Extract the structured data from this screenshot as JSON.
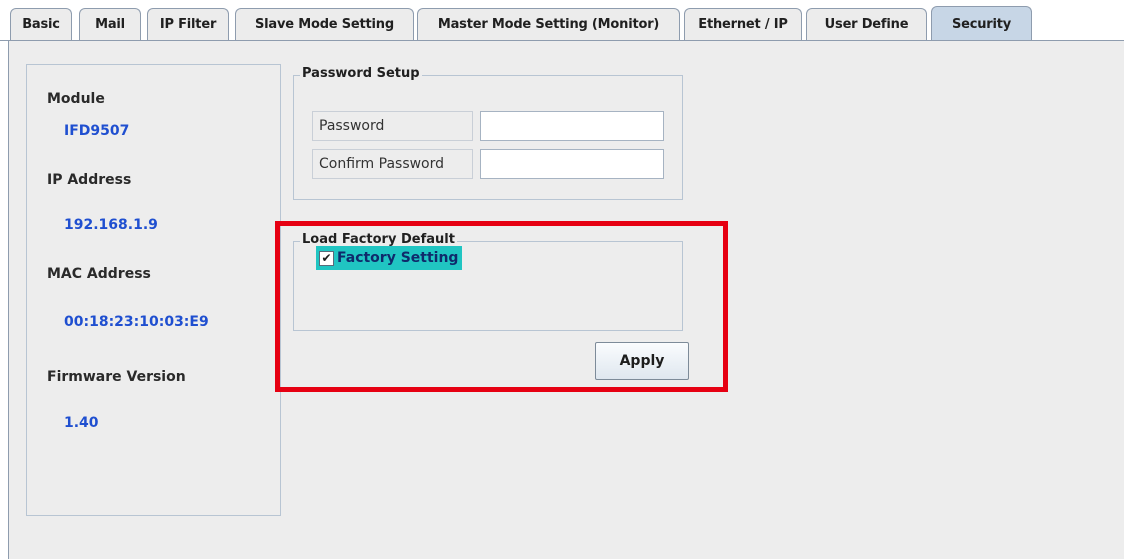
{
  "tabs": [
    {
      "label": "Basic"
    },
    {
      "label": "Mail"
    },
    {
      "label": "IP Filter"
    },
    {
      "label": "Slave Mode Setting"
    },
    {
      "label": "Master Mode Setting (Monitor)"
    },
    {
      "label": "Ethernet / IP"
    },
    {
      "label": "User Define"
    },
    {
      "label": "Security",
      "active": true
    }
  ],
  "info": {
    "module_label": "Module",
    "module_value": "IFD9507",
    "ip_label": "IP Address",
    "ip_value": "192.168.1.9",
    "mac_label": "MAC Address",
    "mac_value": "00:18:23:10:03:E9",
    "firmware_label": "Firmware Version",
    "firmware_value": "1.40"
  },
  "password_setup": {
    "title": "Password Setup",
    "password_label": "Password",
    "password_value": "",
    "confirm_label": "Confirm Password",
    "confirm_value": ""
  },
  "factory_default": {
    "title": "Load Factory Default",
    "checkbox_label": "Factory Setting",
    "checked": true,
    "check_glyph": "✔"
  },
  "apply_label": "Apply",
  "colors": {
    "accent_blue": "#1f4fd0",
    "highlight_red": "#e60012",
    "checkbox_bg": "#20c5c2",
    "active_tab": "#c7d6e6"
  }
}
